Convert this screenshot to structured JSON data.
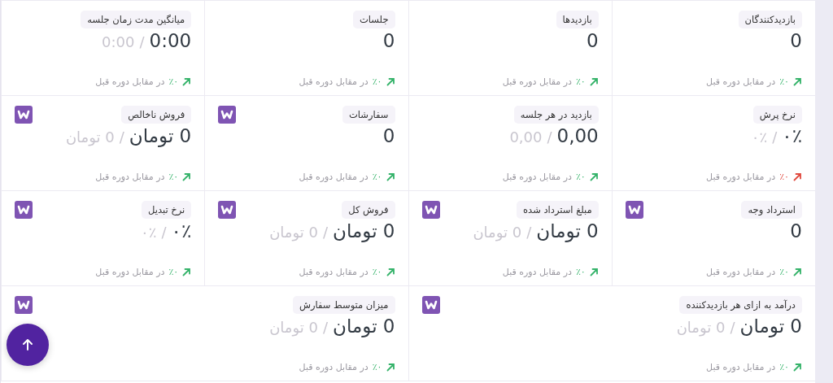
{
  "cards": [
    {
      "label": "بازدیدکنندگان",
      "value": "0",
      "change": "٪۰",
      "negative": false,
      "woo": false,
      "wide": false,
      "note": "در مقابل دوره قبل"
    },
    {
      "label": "بازدیدها",
      "value": "0",
      "change": "٪۰",
      "negative": false,
      "woo": false,
      "wide": false,
      "note": "در مقابل دوره قبل"
    },
    {
      "label": "جلسات",
      "value": "0",
      "change": "٪۰",
      "negative": false,
      "woo": false,
      "wide": false,
      "note": "در مقابل دوره قبل"
    },
    {
      "label": "میانگین مدت زمان جلسه",
      "value": "0:00",
      "separator": "/",
      "previous": "0:00",
      "change": "٪۰",
      "negative": false,
      "woo": false,
      "wide": false,
      "note": "در مقابل دوره قبل"
    },
    {
      "label": "نرخ پرش",
      "value": "۰٪",
      "separator": "/",
      "previous": "۰٪",
      "change": "٪۰",
      "negative": true,
      "woo": false,
      "wide": false,
      "note": "در مقابل دوره قبل"
    },
    {
      "label": "بازدید در هر جلسه",
      "value": "0,00",
      "separator": "/",
      "previous": "0,00",
      "change": "٪۰",
      "negative": false,
      "woo": false,
      "wide": false,
      "note": "در مقابل دوره قبل"
    },
    {
      "label": "سفارشات",
      "value": "0",
      "change": "٪۰",
      "negative": false,
      "woo": true,
      "wide": false,
      "note": "در مقابل دوره قبل"
    },
    {
      "label": "فروش ناخالص",
      "value": "0 تومان",
      "separator": "/",
      "previous": "0 تومان",
      "change": "٪۰",
      "negative": false,
      "woo": true,
      "wide": false,
      "note": "در مقابل دوره قبل"
    },
    {
      "label": "استرداد وجه",
      "value": "0",
      "change": "٪۰",
      "negative": false,
      "woo": true,
      "wide": false,
      "note": "در مقابل دوره قبل"
    },
    {
      "label": "مبلغ استرداد شده",
      "value": "0 تومان",
      "separator": "/",
      "previous": "0 تومان",
      "change": "٪۰",
      "negative": false,
      "woo": true,
      "wide": false,
      "note": "در مقابل دوره قبل"
    },
    {
      "label": "فروش کل",
      "value": "0 تومان",
      "separator": "/",
      "previous": "0 تومان",
      "change": "٪۰",
      "negative": false,
      "woo": true,
      "wide": false,
      "note": "در مقابل دوره قبل"
    },
    {
      "label": "نرخ تبدیل",
      "value": "۰٪",
      "separator": "/",
      "previous": "۰٪",
      "change": "٪۰",
      "negative": false,
      "woo": true,
      "wide": false,
      "note": "در مقابل دوره قبل"
    },
    {
      "label": "درآمد به ازای هر بازدیدکننده",
      "value": "0 تومان",
      "separator": "/",
      "previous": "0 تومان",
      "change": "٪۰",
      "negative": false,
      "woo": true,
      "wide": true,
      "note": "در مقابل دوره قبل"
    },
    {
      "label": "میزان متوسط سفارش",
      "value": "0 تومان",
      "separator": "/",
      "previous": "0 تومان",
      "change": "٪۰",
      "negative": false,
      "woo": true,
      "wide": true,
      "note": "در مقابل دوره قبل"
    }
  ],
  "scroll_top_button": {
    "visible": true
  }
}
